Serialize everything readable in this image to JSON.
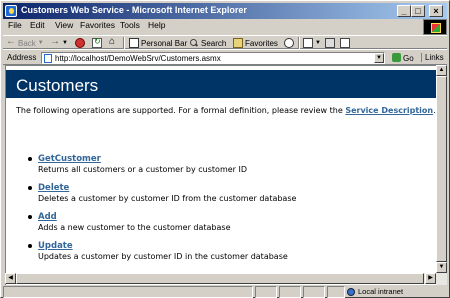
{
  "window": {
    "title": "Customers Web Service - Microsoft Internet Explorer"
  },
  "menu": [
    "File",
    "Edit",
    "View",
    "Favorites",
    "Tools",
    "Help"
  ],
  "toolbar": {
    "back_label": "Back",
    "personal_bar_label": "Personal Bar",
    "search_label": "Search",
    "favorites_label": "Favorites"
  },
  "address": {
    "label": "Address",
    "url": "http://localhost/DemoWebSrv/Customers.asmx",
    "go_label": "Go",
    "links_label": "Links"
  },
  "page": {
    "heading": "Customers",
    "intro_text": "The following operations are supported. For a formal definition, please review the",
    "intro_link": "Service Description",
    "intro_end": ".",
    "operations": [
      {
        "name": "GetCustomer",
        "description": "Returns all customers or a customer by customer ID"
      },
      {
        "name": "Delete",
        "description": "Deletes a customer by customer ID from the customer database"
      },
      {
        "name": "Add",
        "description": "Adds a new customer to the customer database"
      },
      {
        "name": "Update",
        "description": "Updates a customer by customer ID in the customer database"
      }
    ]
  },
  "status": {
    "zone": "Local intranet"
  },
  "colors": {
    "heading_bar": "#003366",
    "link": "#336699",
    "titlebar_start": "#0a246a"
  }
}
